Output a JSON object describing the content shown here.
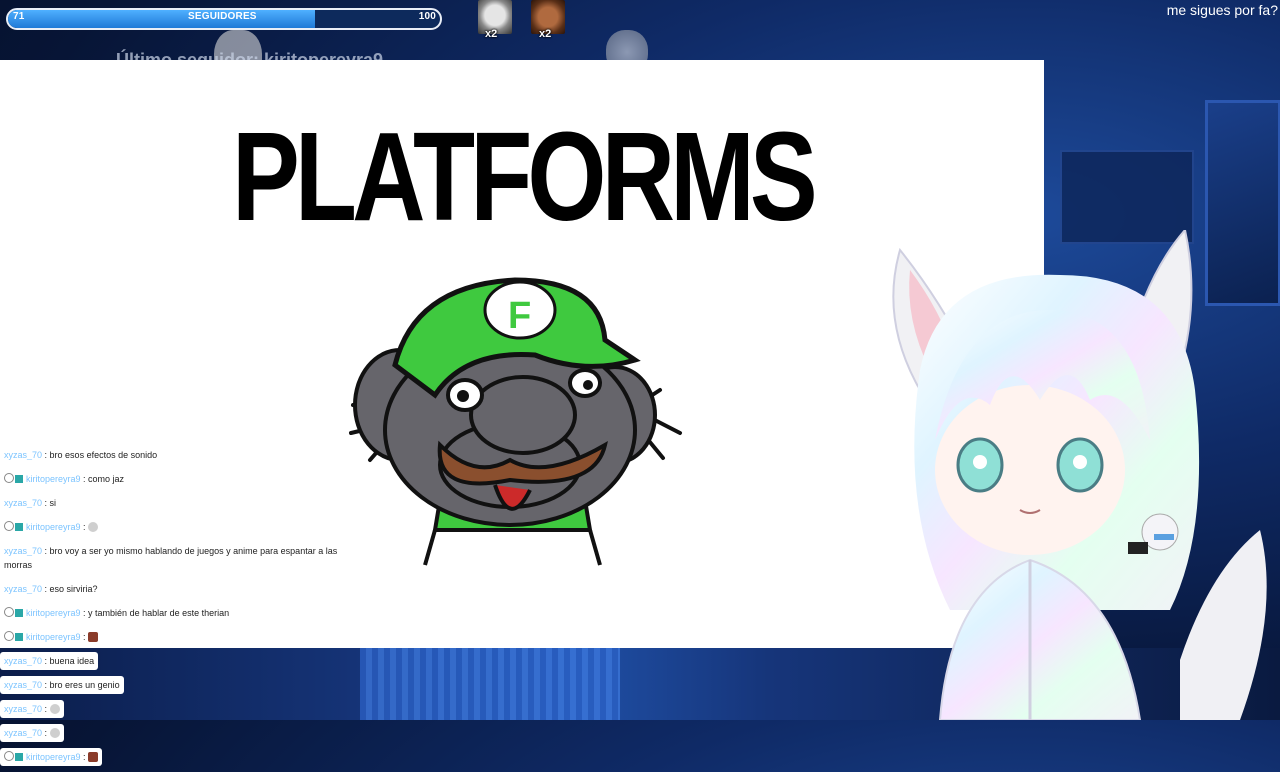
{
  "follower_goal": {
    "min": "71",
    "label": "SEGUIDORES",
    "max": "100",
    "progress_fraction": 0.71
  },
  "emotes": [
    {
      "name": "cat-emote",
      "multiplier": "x2"
    },
    {
      "name": "man-emote",
      "multiplier": "x2"
    }
  ],
  "last_follower": "Último seguidor: kiritopereyra9",
  "top_message": "me sigues por fa?",
  "meme": {
    "title": "PLATFORMS",
    "cap_letter": "F"
  },
  "chat": [
    {
      "user": "xyzas_70",
      "text": "bro esos efectos de sonido",
      "badges": false
    },
    {
      "user": "kiritopereyra9",
      "text": "como jaz",
      "badges": true
    },
    {
      "user": "xyzas_70",
      "text": "si",
      "badges": false
    },
    {
      "user": "kiritopereyra9",
      "text": "",
      "badges": true,
      "emote": "cat"
    },
    {
      "user": "xyzas_70",
      "text": "bro voy a ser yo mismo hablando de juegos y anime para espantar a las morras",
      "badges": false,
      "wrap": true
    },
    {
      "user": "xyzas_70",
      "text": "eso sirviria?",
      "badges": false
    },
    {
      "user": "kiritopereyra9",
      "text": "y también de hablar de este therian",
      "badges": true
    },
    {
      "user": "kiritopereyra9",
      "text": "",
      "badges": true,
      "emote": "brown"
    },
    {
      "user": "xyzas_70",
      "text": "buena idea",
      "badges": false
    },
    {
      "user": "xyzas_70",
      "text": "bro eres un genio",
      "badges": false
    },
    {
      "user": "xyzas_70",
      "text": "",
      "badges": false,
      "emote": "cat"
    },
    {
      "user": "xyzas_70",
      "text": "",
      "badges": false,
      "emote": "cat"
    },
    {
      "user": "kiritopereyra9",
      "text": "",
      "badges": true,
      "emote": "brown"
    }
  ],
  "colors": {
    "goal_fill": "#1f79d6",
    "chat_user": "#4fb0ff",
    "cap_green": "#3fc93f",
    "mouse_gray": "#66656b"
  }
}
